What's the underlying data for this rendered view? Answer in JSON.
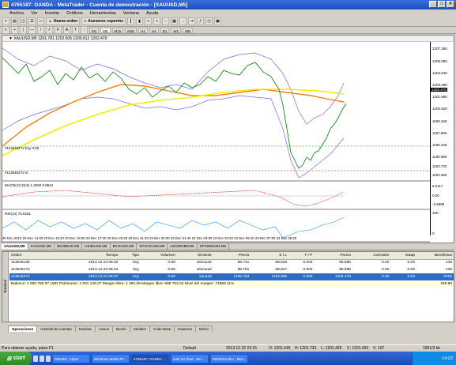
{
  "window": {
    "title": "4765187: OANDA - MetaTrader - Cuenta de demostración - [XAUUSD,M5]"
  },
  "menu": [
    "Archivo",
    "Ver",
    "Insertar",
    "Gráficos",
    "Herramientas",
    "Ventana",
    "Ayuda"
  ],
  "toolbar": {
    "new_order": "Nueva orden",
    "experts": "Asesores expertos"
  },
  "timeframes": [
    "M1",
    "M5",
    "M15",
    "M30",
    "H1",
    "H4",
    "D1",
    "W1",
    "MN"
  ],
  "chart": {
    "header": "▼ XAUUSD,M5  1201.781 1202.505 1200.612 1202.470",
    "price_axis": [
      "1207.360",
      "1205.880",
      "1204.640",
      "1203.280",
      "1201.880",
      "1200.520",
      "1199.160",
      "1197.800",
      "1196.440",
      "1195.080",
      "1193.720",
      "1192.360"
    ],
    "current_price": "1202.470",
    "line_buy_label": "#113646272 buy 0.50",
    "line_sl_label": "#113646272 sl",
    "macd_label": "MACD(12,26,9) 1.3260 0.8941",
    "macd_axis": [
      "6.0117",
      "0.00",
      "-2.5685"
    ],
    "rsi_label": "RSI(14) 75.5251",
    "rsi_axis": [
      "100",
      "0"
    ],
    "time_axis": "20 Dec 2013  20 Dec 14:40  20 Dec 15:20  20 Dec 16:00  20 Dec 17:00  20 Dec 20:20  20 Dec 21:40  23 Dec 00:20  23 Dec 01:40  23 Dec 03:00  23 Dec 04:20  23 Dec 05:40  23 Dec 07:00  23 Dec 08:20"
  },
  "chart_tabs": [
    "XAUUSD,M5",
    "XAGUSD,M5",
    "DE30EUR,M5",
    "US30USD,M5",
    "BCOUSD,M5",
    "WTICOUSD,M5",
    "UK100GBP,M5",
    "SPX500USD,M5"
  ],
  "orders": {
    "columns": [
      "Orden",
      "Tiempo",
      "Tipo",
      "Volumen",
      "Símbolo",
      "Precio",
      "S / L",
      "T / P",
      "Precio",
      "Comisión",
      "Swap",
      "Beneficios"
    ],
    "rows": [
      [
        "113646135",
        "2013.12.23 06:32",
        "buy",
        "0.90",
        "wticousd",
        "98.741",
        "98.629",
        "0.000",
        "98.886",
        "0.00",
        "0.00",
        "145"
      ],
      [
        "113646172",
        "2013.12.23 06:34",
        "buy",
        "0.90",
        "wticousd",
        "98.751",
        "98.627",
        "0.000",
        "98.886",
        "0.00",
        "0.00",
        "135"
      ],
      [
        "113646272",
        "2013.12.23 06:37",
        "buy",
        "0.50",
        "xauusd",
        "1195.764",
        "1193.000",
        "0.000",
        "1202.470",
        "0.00",
        "0.00",
        "6706"
      ]
    ],
    "balance": "Balance: 1 000 796.37 USD  Patrimonio: 1 001 145.27  Margen libre: 1 393.26  Margen libre: 999 752.01  Nivel del margen: 71856.11%",
    "balance_total": "348.90"
  },
  "terminal_side": "Terminal",
  "terminal_tabs": [
    "Operaciones",
    "Historial de cuentas",
    "Noticias",
    "Avisos",
    "Buzón",
    "Señales",
    "Code Base",
    "Expertos",
    "Diario"
  ],
  "status": {
    "help": "Para obtener ayuda, pulse F1",
    "profile": "Default",
    "datetime": "2013.12.22 23:15",
    "o": "O: 1201.645",
    "h": "H: 1201.733",
    "l": "L: 1201.429",
    "c": "C: 1201.433",
    "v": "V: 107",
    "traffic": "1901/3 kb"
  },
  "taskbar": {
    "start": "start",
    "tasks": [
      "005293 - Alpari ...",
      "Windows Media Pl...",
      "4765187: OANDA ...",
      "Ivan lnz Ihue - Mo...",
      "INDICES.doc - Micr..."
    ],
    "clock": "14:22"
  }
}
